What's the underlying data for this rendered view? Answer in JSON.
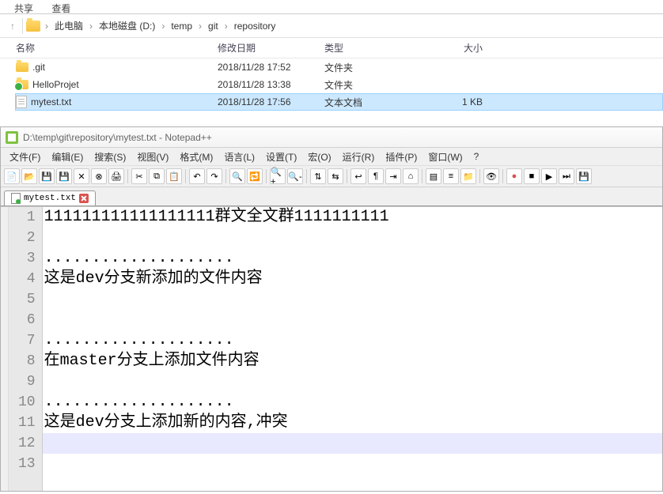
{
  "explorer": {
    "ribbon_tabs": [
      "共享",
      "查看"
    ],
    "breadcrumb": [
      "此电脑",
      "本地磁盘 (D:)",
      "temp",
      "git",
      "repository"
    ],
    "columns": {
      "name": "名称",
      "date": "修改日期",
      "type": "类型",
      "size": "大小"
    },
    "files": [
      {
        "name": ".git",
        "date": "2018/11/28 17:52",
        "type": "文件夹",
        "size": "",
        "icon": "folder"
      },
      {
        "name": "HelloProjet",
        "date": "2018/11/28 13:38",
        "type": "文件夹",
        "size": "",
        "icon": "folder-git"
      },
      {
        "name": "mytest.txt",
        "date": "2018/11/28 17:56",
        "type": "文本文档",
        "size": "1 KB",
        "icon": "txt",
        "selected": true
      }
    ]
  },
  "npp": {
    "title": "D:\\temp\\git\\repository\\mytest.txt - Notepad++",
    "menu": [
      "文件(F)",
      "编辑(E)",
      "搜索(S)",
      "视图(V)",
      "格式(M)",
      "语言(L)",
      "设置(T)",
      "宏(O)",
      "运行(R)",
      "插件(P)",
      "窗口(W)",
      "?"
    ],
    "toolbar_icons": [
      "new-icon",
      "open-icon",
      "save-icon",
      "save-all-icon",
      "close-icon",
      "close-all-icon",
      "print-icon",
      "sep",
      "cut-icon",
      "copy-icon",
      "paste-icon",
      "sep",
      "undo-icon",
      "redo-icon",
      "sep",
      "find-icon",
      "replace-icon",
      "sep",
      "zoom-in-icon",
      "zoom-out-icon",
      "sep",
      "sync-v-icon",
      "sync-h-icon",
      "sep",
      "wrap-icon",
      "chars-icon",
      "indent-icon",
      "lang-icon",
      "sep",
      "doc-map-icon",
      "func-list-icon",
      "folder-icon",
      "sep",
      "monitor-icon",
      "sep",
      "record-icon",
      "stop-icon",
      "play-icon",
      "play-multi-icon",
      "save-macro-icon"
    ],
    "tab_name": "mytest.txt",
    "lines": [
      "111111111111111111群文全文群1111111111",
      "",
      "....................",
      "这是dev分支新添加的文件内容",
      "",
      "",
      "....................",
      "在master分支上添加文件内容",
      "",
      "....................",
      "这是dev分支上添加新的内容,冲突",
      "",
      ""
    ],
    "current_line_index": 11
  }
}
